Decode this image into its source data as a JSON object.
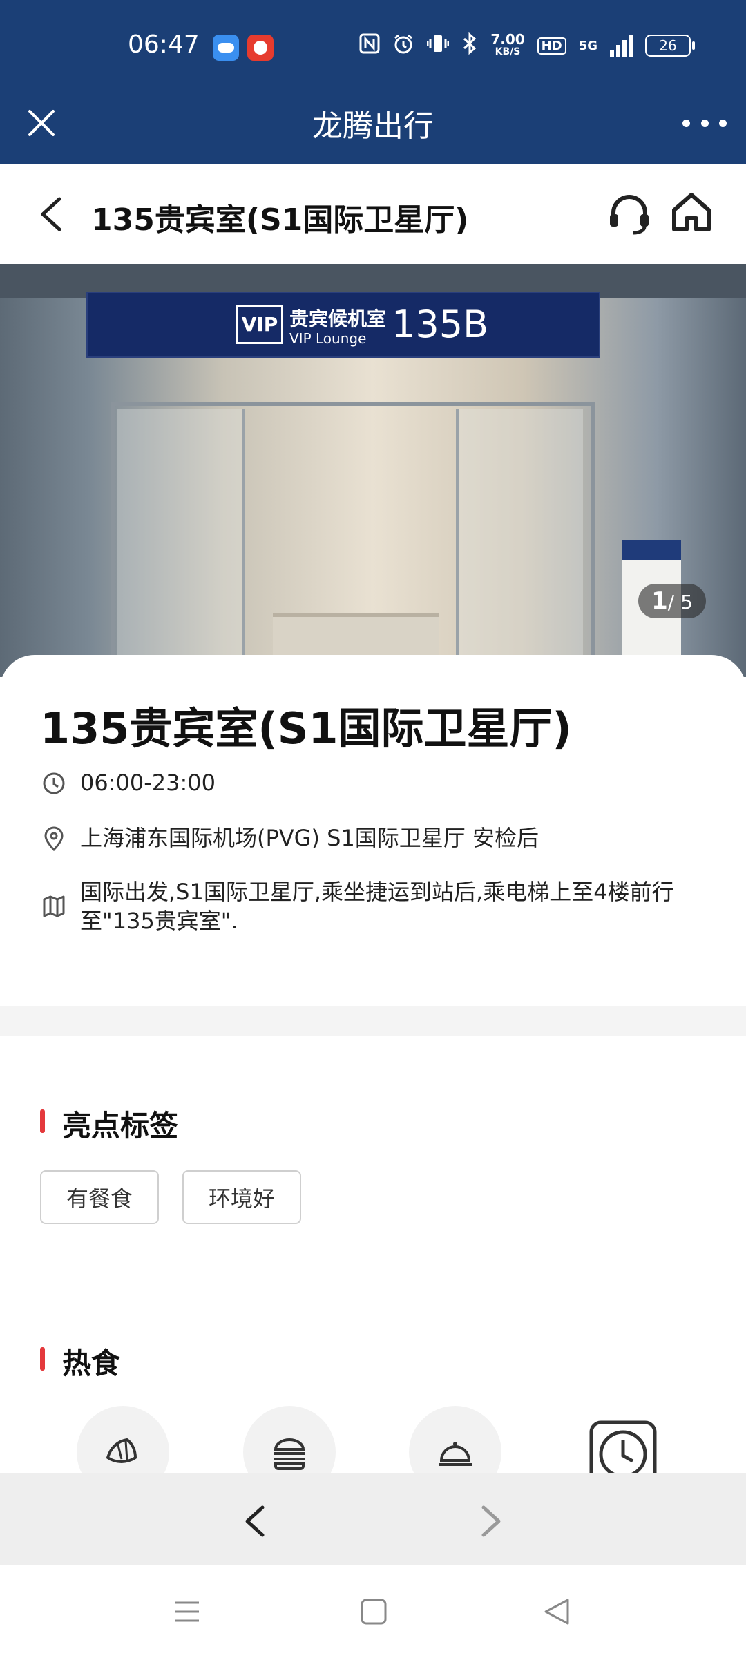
{
  "status_bar": {
    "time": "06:47",
    "net_speed_value": "7.00",
    "net_speed_unit": "KB/S",
    "hd": "HD",
    "network": "5G",
    "battery": "26"
  },
  "app_header": {
    "title": "龙腾出行"
  },
  "page_nav": {
    "title": "135贵宾室(S1国际卫星厅)"
  },
  "hero": {
    "sign_vip": "VIP",
    "sign_cn": "贵宾候机室",
    "sign_en": "VIP Lounge",
    "sign_number": "135B",
    "counter_current": "1",
    "counter_total": "/ 5"
  },
  "venue": {
    "title": "135贵宾室(S1国际卫星厅)",
    "hours": "06:00-23:00",
    "address": "上海浦东国际机场(PVG) S1国际卫星厅 安检后",
    "route": "国际出发,S1国际卫星厅,乘坐捷运到站后,乘电梯上至4楼前行至\"135贵宾室\"."
  },
  "highlights": {
    "title": "亮点标签",
    "tags": [
      "有餐食",
      "环境好"
    ]
  },
  "hot_food": {
    "title": "热食",
    "icons": [
      "croissant-icon",
      "burger-icon",
      "cloche-icon",
      "clock-icon"
    ]
  },
  "colors": {
    "header_blue": "#1b3f76",
    "accent_red": "#e4393c"
  }
}
